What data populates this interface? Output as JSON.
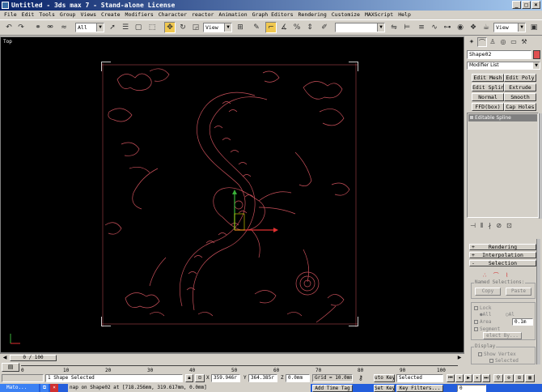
{
  "window": {
    "title": "Untitled - 3ds max 7 - Stand-alone License"
  },
  "menu": [
    "File",
    "Edit",
    "Tools",
    "Group",
    "Views",
    "Create",
    "Modifiers",
    "Character",
    "reactor",
    "Animation",
    "Graph Editors",
    "Rendering",
    "Customize",
    "MAXScript",
    "Help"
  ],
  "toolbar": {
    "selection_filter": "All",
    "ref_coord": "View",
    "named_selection": "",
    "render_view": "View"
  },
  "viewport": {
    "label": "Top"
  },
  "command_panel": {
    "object_name": "Shape02",
    "modifier_list": "Modifier List",
    "buttons": [
      "Edit Mesh",
      "Edit Poly",
      "Edit Spline",
      "Extrude",
      "Normal",
      "Smooth",
      "FFD(box)",
      "Cap Holes"
    ],
    "stack_item": "Editable Spline",
    "rollouts": {
      "rendering": "Rendering",
      "interpolation": "Interpolation",
      "selection": "Selection"
    },
    "named_selections": {
      "title": "Named Selections:",
      "copy": "Copy",
      "paste": "Paste"
    },
    "lock": "Lock",
    "all": "All",
    "al": "Al",
    "area": "Area",
    "area_value": "0.1m",
    "segment": "Segment",
    "select_by": "elect By...",
    "display": {
      "title": "Display",
      "show_vertex": "Show Vertex",
      "selected": "Selected"
    }
  },
  "timeline": {
    "frame_display": "0 / 100",
    "ticks": [
      "0",
      "10",
      "20",
      "30",
      "40",
      "50",
      "60",
      "70",
      "80",
      "90",
      "100"
    ]
  },
  "status": {
    "selection": "1 Shape Selected",
    "prompt": "nap on Shape02 at [718.256mm, 319.617mm, 0.0mm]",
    "x_label": "X",
    "x_value": "359.946r",
    "y_label": "Y",
    "y_value": "364.385r",
    "z_label": "Z",
    "z_value": "0.0mm",
    "grid": "Grid = 10.0mm",
    "add_time_tag": "Add Time Tag",
    "auto_key": "uto Key",
    "set_key": "Set Key",
    "key_filter_mode": "Selected",
    "key_filters": "Key Filters...",
    "current_frame": "0"
  },
  "taskbar": {
    "app_button": "Mato..."
  }
}
